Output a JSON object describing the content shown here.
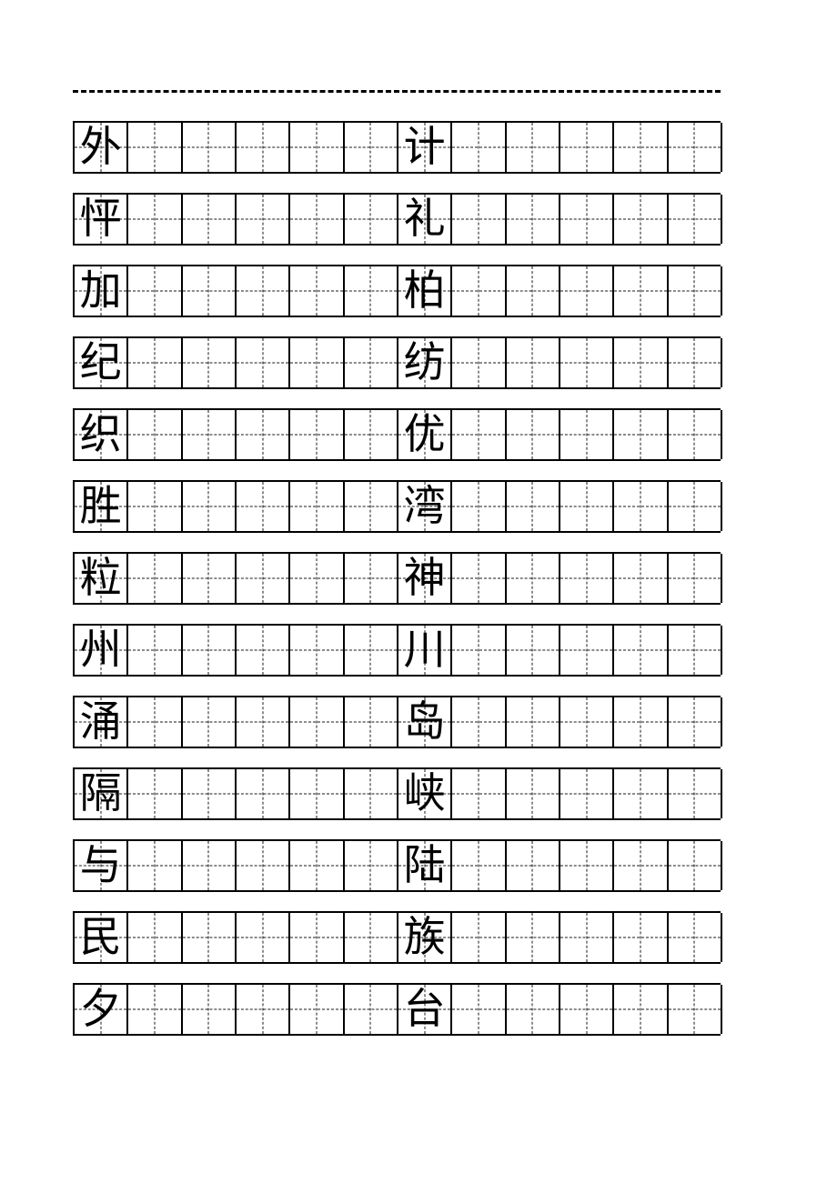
{
  "document": {
    "kind": "chinese-character-handwriting-practice-worksheet",
    "grid_style": "tianzige",
    "columns_per_row": 12,
    "rows_count": 13,
    "ink_color": "#000000",
    "guide_color": "#1a1a1a",
    "background_color": "#ffffff",
    "cut_line": {
      "present": true,
      "style": "dashed"
    }
  },
  "rows": [
    {
      "index": 1,
      "model_characters": {
        "col1": "外",
        "col7": "计"
      }
    },
    {
      "index": 2,
      "model_characters": {
        "col1": "怦",
        "col7": "礼"
      }
    },
    {
      "index": 3,
      "model_characters": {
        "col1": "加",
        "col7": "柏"
      }
    },
    {
      "index": 4,
      "model_characters": {
        "col1": "纪",
        "col7": "纺"
      }
    },
    {
      "index": 5,
      "model_characters": {
        "col1": "织",
        "col7": "优"
      }
    },
    {
      "index": 6,
      "model_characters": {
        "col1": "胜",
        "col7": "湾"
      }
    },
    {
      "index": 7,
      "model_characters": {
        "col1": "粒",
        "col7": "神"
      }
    },
    {
      "index": 8,
      "model_characters": {
        "col1": "州",
        "col7": "川"
      }
    },
    {
      "index": 9,
      "model_characters": {
        "col1": "涌",
        "col7": "岛"
      }
    },
    {
      "index": 10,
      "model_characters": {
        "col1": "隔",
        "col7": "峡"
      }
    },
    {
      "index": 11,
      "model_characters": {
        "col1": "与",
        "col7": "陆"
      }
    },
    {
      "index": 12,
      "model_characters": {
        "col1": "民",
        "col7": "族"
      }
    },
    {
      "index": 13,
      "model_characters": {
        "col1": "夕",
        "col7": "台"
      }
    }
  ],
  "cells": [
    [
      "外",
      "",
      "",
      "",
      "",
      "",
      "计",
      "",
      "",
      "",
      "",
      ""
    ],
    [
      "怦",
      "",
      "",
      "",
      "",
      "",
      "礼",
      "",
      "",
      "",
      "",
      ""
    ],
    [
      "加",
      "",
      "",
      "",
      "",
      "",
      "柏",
      "",
      "",
      "",
      "",
      ""
    ],
    [
      "纪",
      "",
      "",
      "",
      "",
      "",
      "纺",
      "",
      "",
      "",
      "",
      ""
    ],
    [
      "织",
      "",
      "",
      "",
      "",
      "",
      "优",
      "",
      "",
      "",
      "",
      ""
    ],
    [
      "胜",
      "",
      "",
      "",
      "",
      "",
      "湾",
      "",
      "",
      "",
      "",
      ""
    ],
    [
      "粒",
      "",
      "",
      "",
      "",
      "",
      "神",
      "",
      "",
      "",
      "",
      ""
    ],
    [
      "州",
      "",
      "",
      "",
      "",
      "",
      "川",
      "",
      "",
      "",
      "",
      ""
    ],
    [
      "涌",
      "",
      "",
      "",
      "",
      "",
      "岛",
      "",
      "",
      "",
      "",
      ""
    ],
    [
      "隔",
      "",
      "",
      "",
      "",
      "",
      "峡",
      "",
      "",
      "",
      "",
      ""
    ],
    [
      "与",
      "",
      "",
      "",
      "",
      "",
      "陆",
      "",
      "",
      "",
      "",
      ""
    ],
    [
      "民",
      "",
      "",
      "",
      "",
      "",
      "族",
      "",
      "",
      "",
      "",
      ""
    ],
    [
      "夕",
      "",
      "",
      "",
      "",
      "",
      "台",
      "",
      "",
      "",
      "",
      ""
    ]
  ]
}
